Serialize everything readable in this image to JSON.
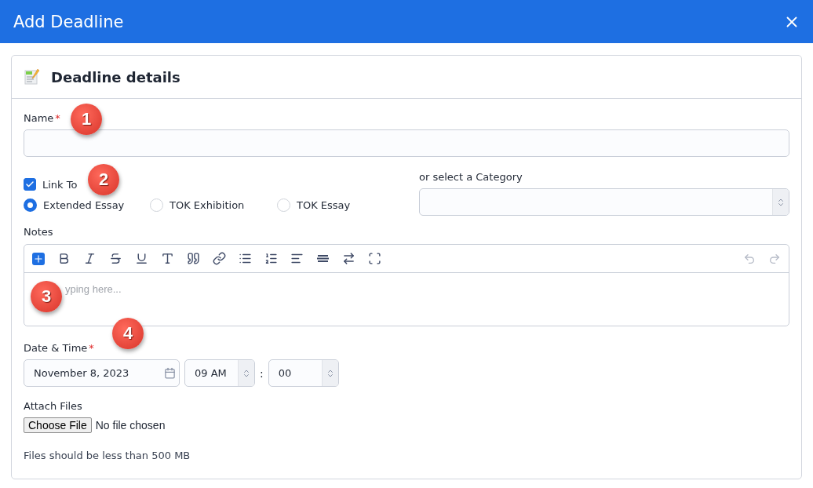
{
  "dialog": {
    "title": "Add Deadline"
  },
  "card": {
    "title": "Deadline details"
  },
  "name_field": {
    "label": "Name",
    "required": true,
    "required_mark": "*",
    "callout": "1"
  },
  "link_to": {
    "label": "Link To",
    "checked": true,
    "callout": "2",
    "options": [
      {
        "label": "Extended Essay",
        "selected": true
      },
      {
        "label": "TOK Exhibition",
        "selected": false
      },
      {
        "label": "TOK Essay",
        "selected": false
      }
    ]
  },
  "category": {
    "label": "or select a Category"
  },
  "notes": {
    "label": "Notes",
    "placeholder": "yping here...",
    "callout": "3",
    "undo": {
      "disabled": true
    },
    "redo": {
      "disabled": true
    }
  },
  "date_time": {
    "label": "Date & Time",
    "required": true,
    "required_mark": "*",
    "callout": "4",
    "date": "November 8, 2023",
    "hour": "09 AM",
    "separator": ":",
    "minute": "00"
  },
  "attach": {
    "label": "Attach Files",
    "button": "Choose File",
    "status": "No file chosen",
    "hint": "Files should be less than 500 MB"
  }
}
